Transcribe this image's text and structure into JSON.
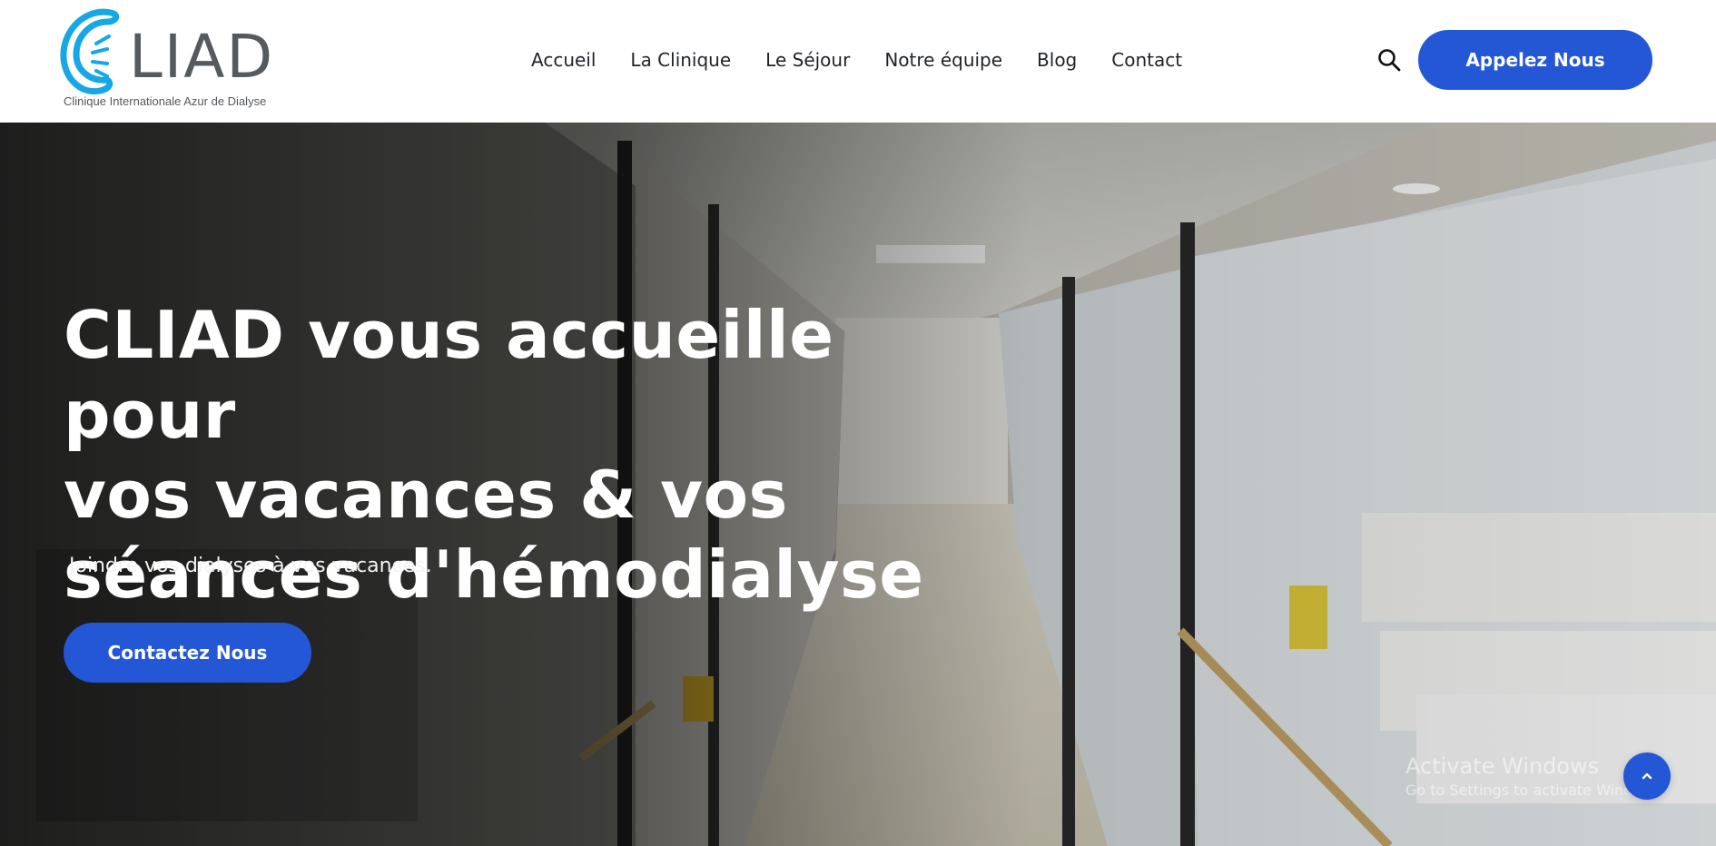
{
  "brand": {
    "name": "LIAD",
    "tagline": "Clinique Internationale Azur de Dialyse",
    "logo_icon": "kidney-c-logo",
    "accent_color": "#18a7e6"
  },
  "nav": {
    "items": [
      {
        "label": "Accueil"
      },
      {
        "label": "La Clinique"
      },
      {
        "label": "Le Séjour"
      },
      {
        "label": "Notre équipe"
      },
      {
        "label": "Blog"
      },
      {
        "label": "Contact"
      }
    ],
    "search_icon": "search-icon",
    "call_button": "Appelez Nous"
  },
  "hero": {
    "title_lines": [
      "CLIAD vous accueille pour",
      "vos vacances & vos",
      "séances d'hémodialyse"
    ],
    "subtitle": "Joindre vos dialyses à vos vacances.",
    "cta": "Contactez Nous",
    "background": "hospital-corridor-photo"
  },
  "windows_watermark": {
    "title": "Activate Windows",
    "subtitle": "Go to Settings to activate Windows."
  },
  "scroll_top_icon": "chevron-up-icon",
  "colors": {
    "primary": "#2457d6",
    "text_dark": "#1f2328",
    "white": "#ffffff"
  }
}
